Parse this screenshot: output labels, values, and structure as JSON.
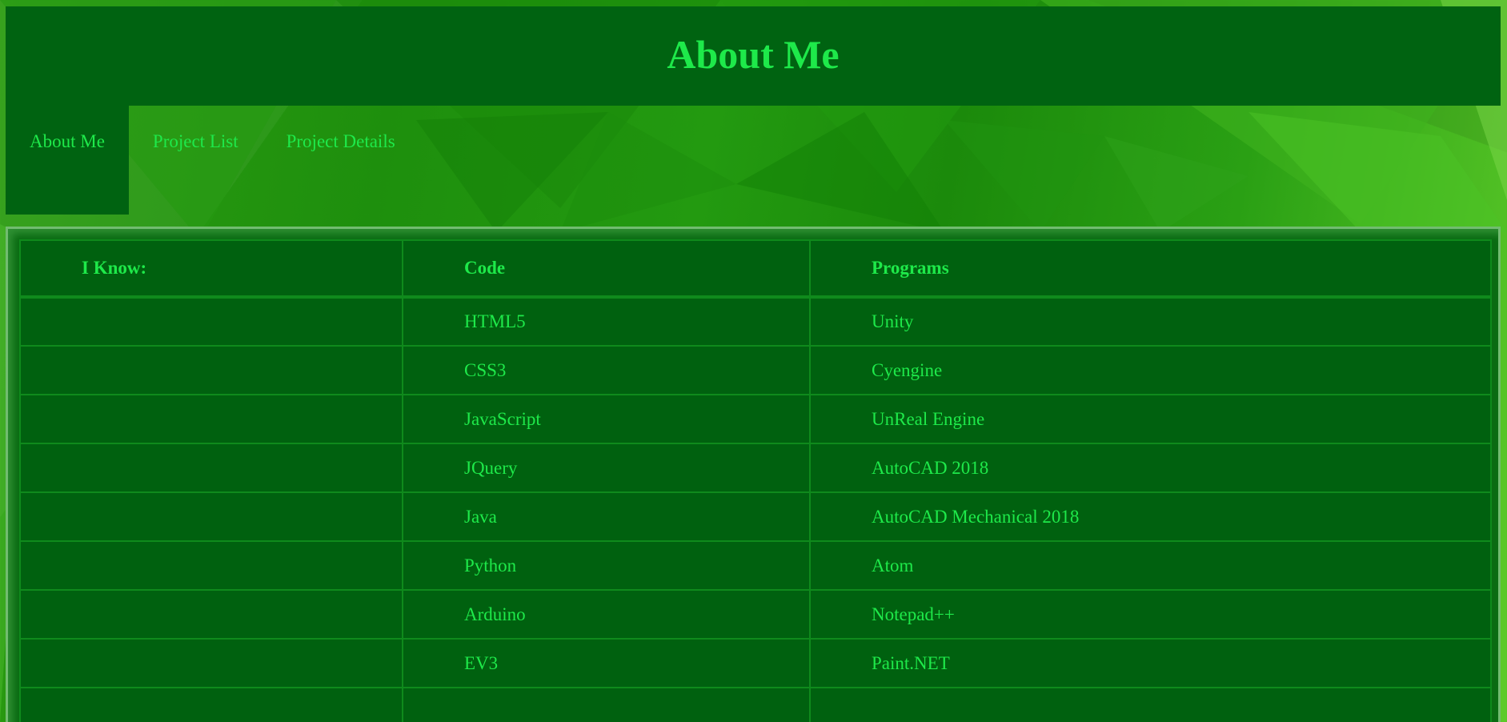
{
  "header": {
    "title": "About Me"
  },
  "nav": {
    "items": [
      {
        "label": "About Me",
        "active": true
      },
      {
        "label": "Project List",
        "active": false
      },
      {
        "label": "Project Details",
        "active": false
      }
    ]
  },
  "skills_table": {
    "headers": [
      "I Know:",
      "Code",
      "Programs"
    ],
    "rows": [
      [
        "",
        "HTML5",
        "Unity"
      ],
      [
        "",
        "CSS3",
        "Cyengine"
      ],
      [
        "",
        "JavaScript",
        "UnReal Engine"
      ],
      [
        "",
        "JQuery",
        "AutoCAD 2018"
      ],
      [
        "",
        "Java",
        "AutoCAD Mechanical 2018"
      ],
      [
        "",
        "Python",
        "Atom"
      ],
      [
        "",
        "Arduino",
        "Notepad++"
      ],
      [
        "",
        "EV3",
        "Paint.NET"
      ],
      [
        "",
        "",
        ""
      ]
    ]
  },
  "colors": {
    "panel_dark_green": "#006311",
    "text_bright_green": "#1ee94a",
    "background_green": "#1e8f0d"
  }
}
